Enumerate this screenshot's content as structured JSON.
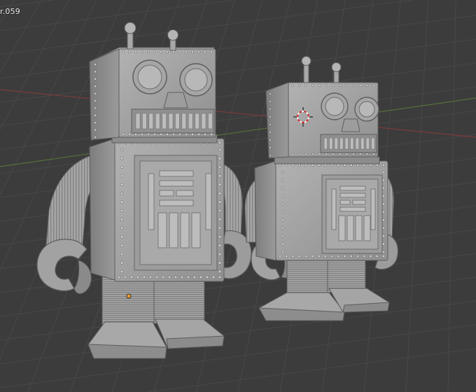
{
  "viewport": {
    "object_label": "r.059",
    "background": "#3c3c3c",
    "grid_color": "#484848",
    "axis_x_color": "#8a3c3c",
    "axis_y_color": "#5a7a3a",
    "model_color": "#a3a3a3"
  },
  "scene": {
    "objects": [
      {
        "name": "robot-large"
      },
      {
        "name": "robot-small"
      }
    ],
    "cursor_icon": "3d-cursor-icon",
    "origin_icon": "object-origin-icon"
  }
}
